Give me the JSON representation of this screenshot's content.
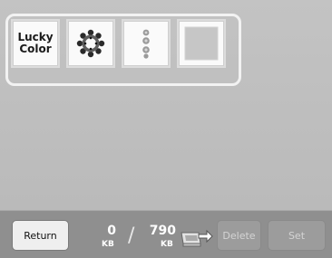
{
  "swatches": [
    {
      "label_line1": "Lucky",
      "label_line2": "Color",
      "icon": "lucky-color-text-icon"
    },
    {
      "icon": "flower-wreath-icon"
    },
    {
      "icon": "vertical-flowers-icon"
    },
    {
      "icon": "blank-square-icon"
    }
  ],
  "footer": {
    "return_label": "Return",
    "used_value": "0",
    "used_unit": "KB",
    "slash": "/",
    "total_value": "790",
    "total_unit": "KB",
    "delete_label": "Delete",
    "set_label": "Set"
  }
}
